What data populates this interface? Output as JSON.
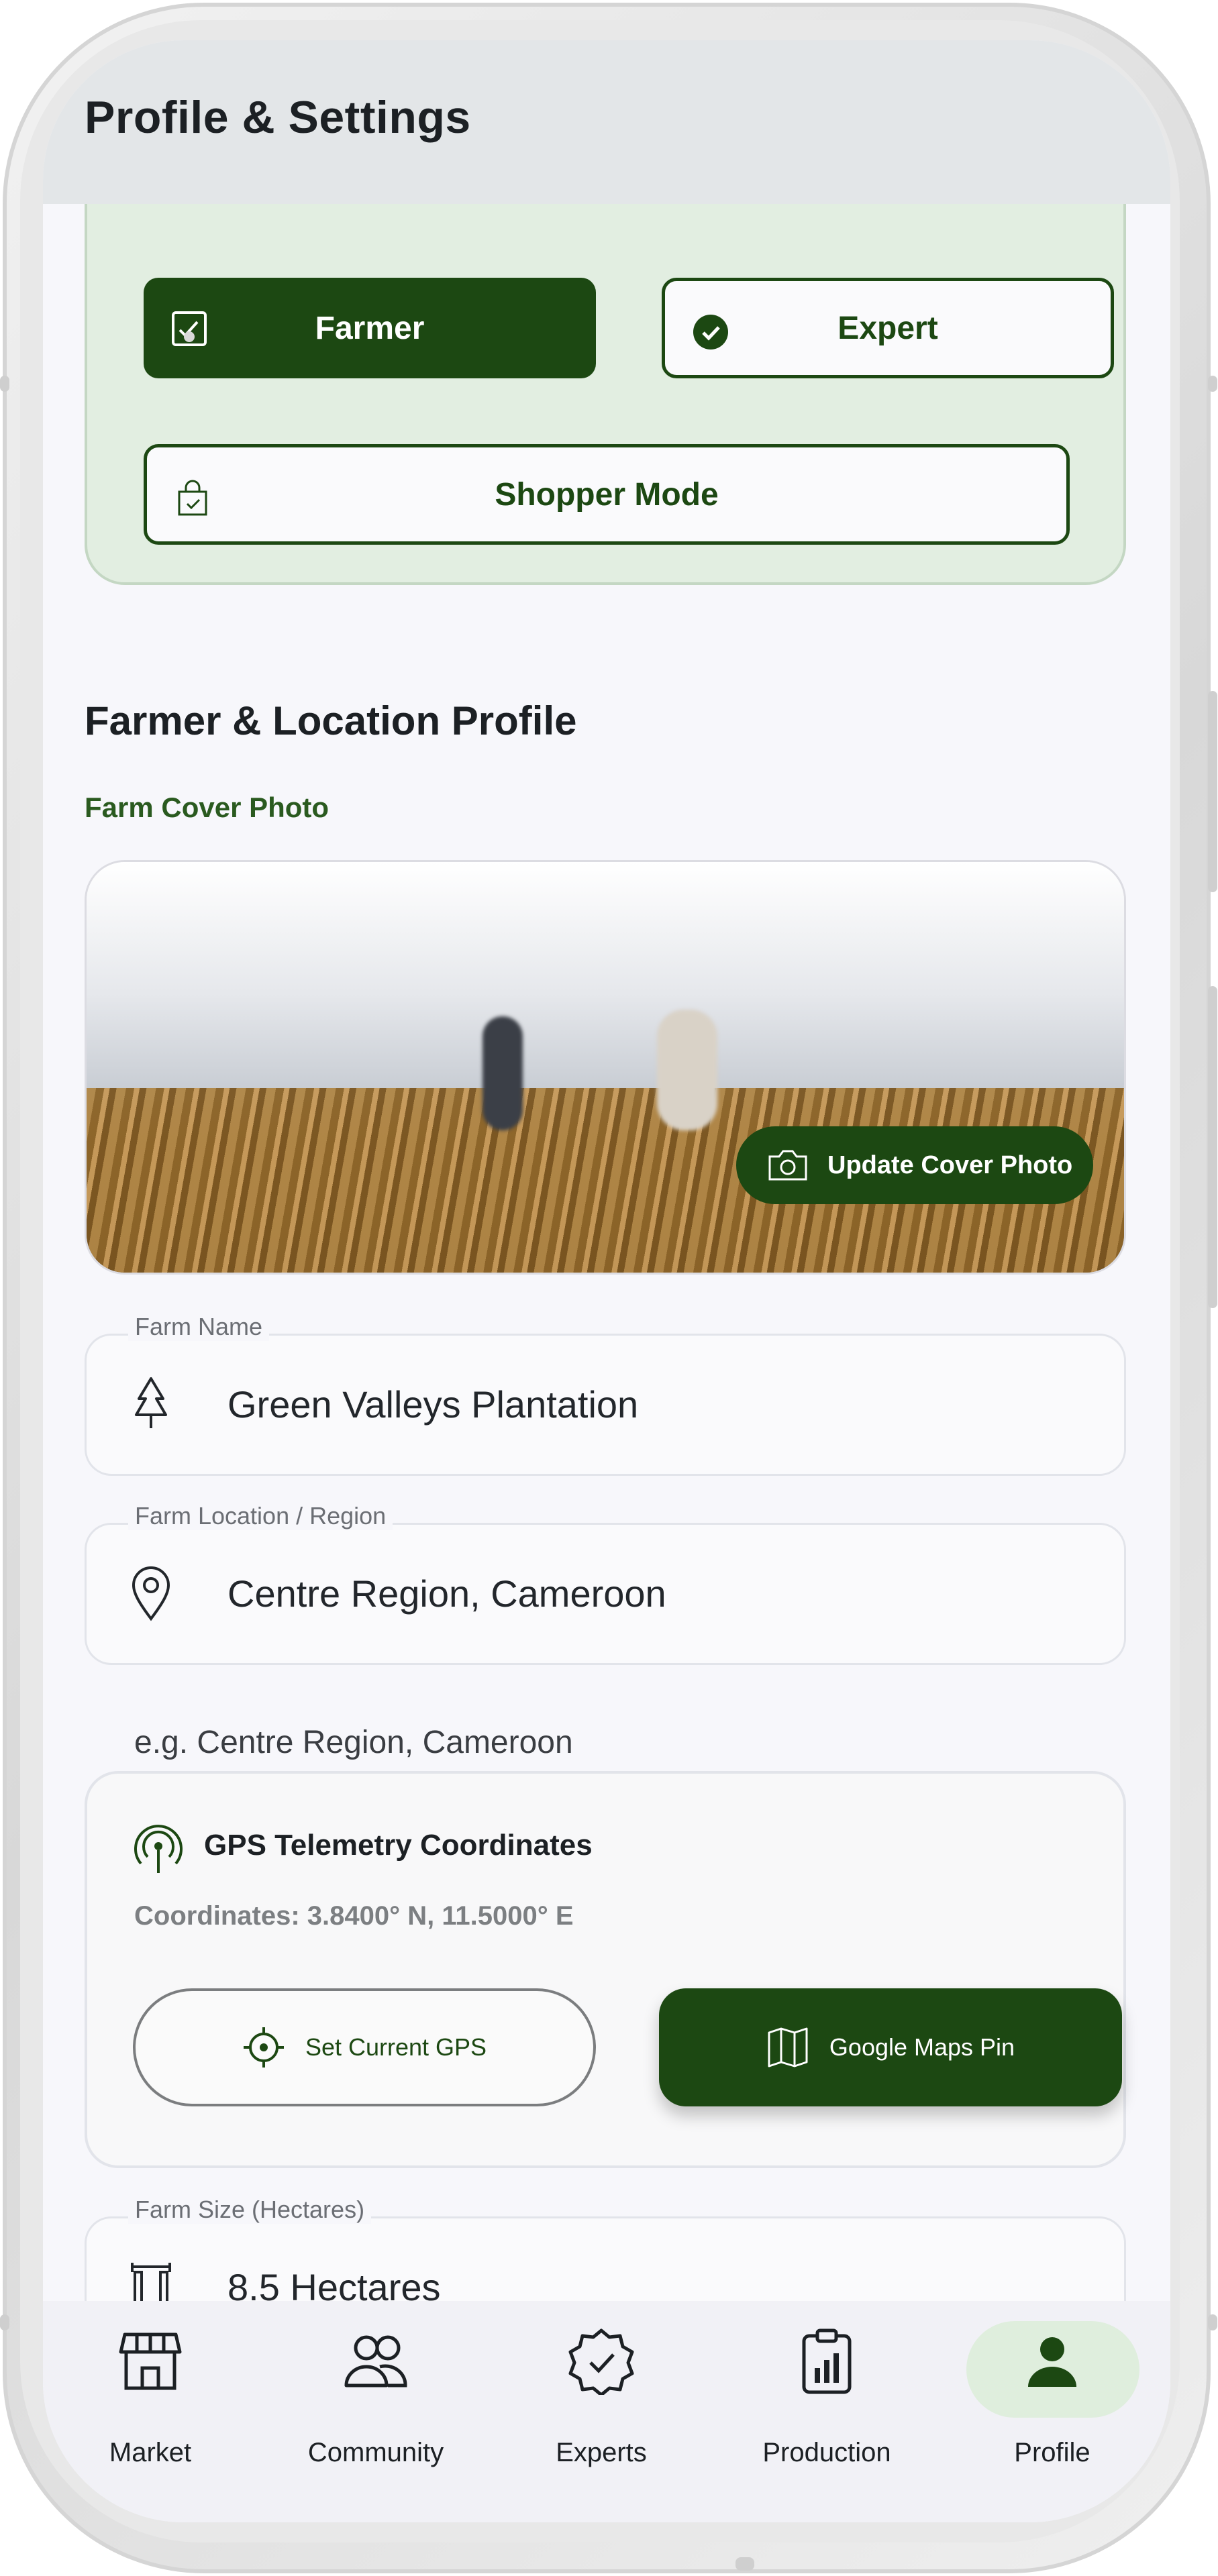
{
  "header": {
    "title": "Profile & Settings"
  },
  "roles": {
    "farmer_label": "Farmer",
    "expert_label": "Expert",
    "shopper_label": "Shopper Mode"
  },
  "profile": {
    "section_title": "Farmer & Location Profile",
    "cover_title": "Farm Cover Photo",
    "update_cover_label": "Update Cover Photo",
    "farm_name": {
      "label": "Farm Name",
      "value": "Green Valleys Plantation"
    },
    "farm_location": {
      "label": "Farm Location / Region",
      "value": "Centre Region, Cameroon",
      "hint": "e.g. Centre Region, Cameroon"
    },
    "farm_size": {
      "label": "Farm Size (Hectares)",
      "value": "8.5 Hectares"
    }
  },
  "gps": {
    "title": "GPS Telemetry Coordinates",
    "coords": "Coordinates: 3.8400° N, 11.5000° E",
    "set_gps_label": "Set Current GPS",
    "maps_pin_label": "Google Maps Pin"
  },
  "nav": {
    "items": [
      {
        "label": "Market",
        "icon": "store-icon"
      },
      {
        "label": "Community",
        "icon": "people-icon"
      },
      {
        "label": "Experts",
        "icon": "verified-badge-icon"
      },
      {
        "label": "Production",
        "icon": "clipboard-chart-icon"
      },
      {
        "label": "Profile",
        "icon": "person-icon"
      }
    ],
    "active": "Profile"
  },
  "colors": {
    "primary": "#1c4812",
    "role_card_bg": "#e2eee1",
    "nav_active_bg": "#dfeedd"
  }
}
